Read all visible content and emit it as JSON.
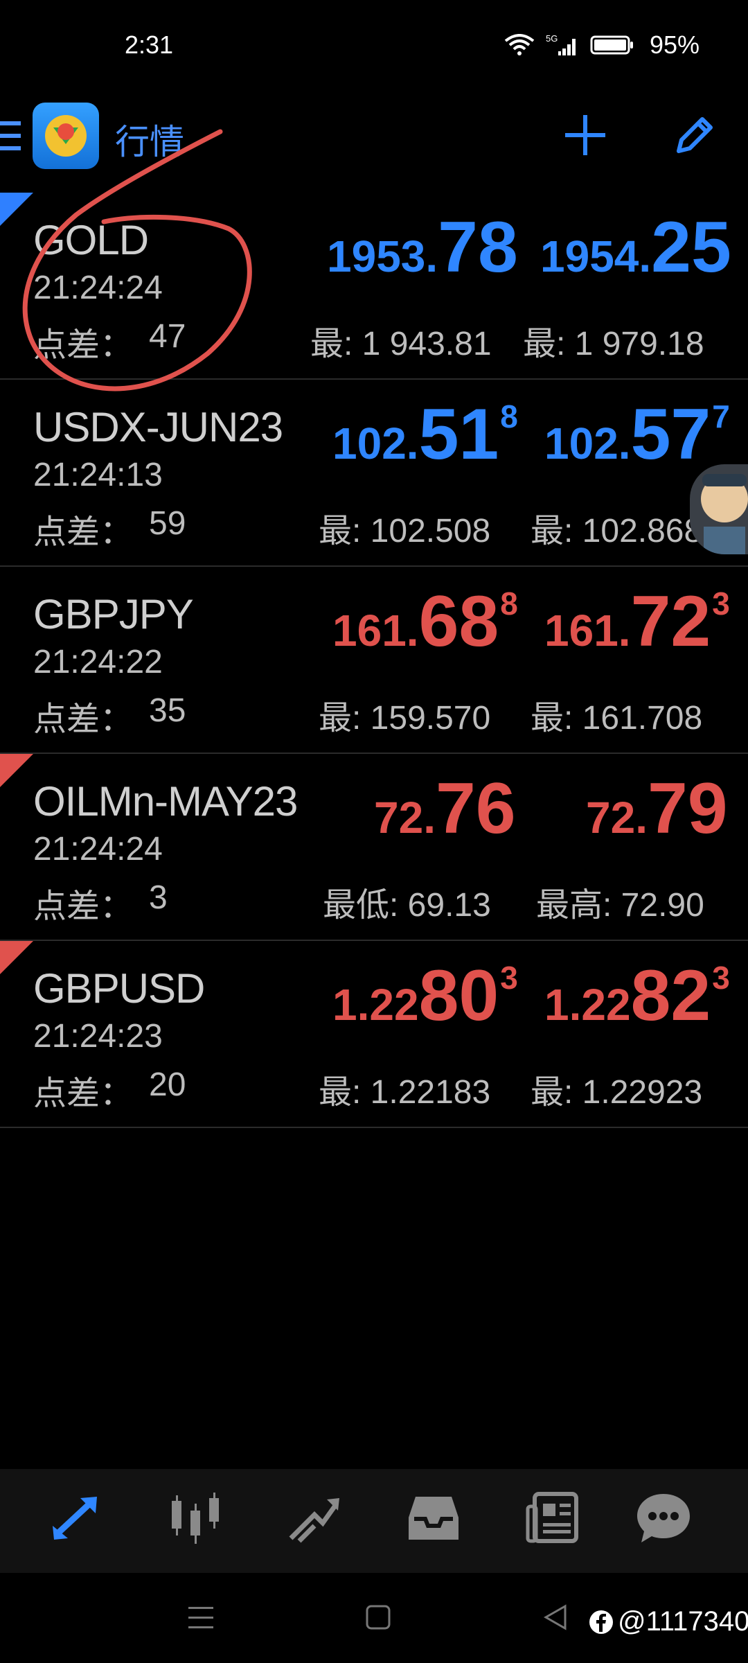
{
  "status": {
    "time": "2:31",
    "battery": "95%"
  },
  "header": {
    "title": "行情"
  },
  "quotes": [
    {
      "symbol": "GOLD",
      "time": "21:24:24",
      "spread_label": "点差：",
      "spread": "47",
      "bid_small": "1953.",
      "bid_big": "78",
      "bid_sup": "",
      "ask_small": "1954.",
      "ask_big": "25",
      "ask_sup": "",
      "low": "最: 1 943.81",
      "high": "最: 1 979.18",
      "color": "#2f86ff"
    },
    {
      "symbol": "USDX-JUN23",
      "time": "21:24:13",
      "spread_label": "点差：",
      "spread": "59",
      "bid_small": "102.",
      "bid_big": "51",
      "bid_sup": "8",
      "ask_small": "102.",
      "ask_big": "57",
      "ask_sup": "7",
      "low": "最: 102.508",
      "high": "最: 102.868",
      "color": "#2f86ff"
    },
    {
      "symbol": "GBPJPY",
      "time": "21:24:22",
      "spread_label": "点差：",
      "spread": "35",
      "bid_small": "161.",
      "bid_big": "68",
      "bid_sup": "8",
      "ask_small": "161.",
      "ask_big": "72",
      "ask_sup": "3",
      "low": "最: 159.570",
      "high": "最: 161.708",
      "color": "#e0524d"
    },
    {
      "symbol": "OILMn-MAY23",
      "time": "21:24:24",
      "spread_label": "点差：",
      "spread": "3",
      "bid_small": "72.",
      "bid_big": "76",
      "bid_sup": "",
      "ask_small": "72.",
      "ask_big": "79",
      "ask_sup": "",
      "low": "最低: 69.13",
      "high": "最高: 72.90",
      "color": "#e0524d"
    },
    {
      "symbol": "GBPUSD",
      "time": "21:24:23",
      "spread_label": "点差：",
      "spread": "20",
      "bid_small": "1.22",
      "bid_big": "80",
      "bid_sup": "3",
      "ask_small": "1.22",
      "ask_big": "82",
      "ask_sup": "3",
      "low": "最: 1.22183",
      "high": "最: 1.22923",
      "color": "#e0524d"
    }
  ],
  "watermark": "@1117340",
  "icons": {
    "menu": "menu-icon",
    "add": "plus-icon",
    "edit": "pencil-icon",
    "tab_quotes": "quotes-arrows-icon",
    "tab_chart": "candlestick-icon",
    "tab_trade": "trend-icon",
    "tab_history": "inbox-icon",
    "tab_news": "news-icon",
    "tab_chat": "chat-icon"
  },
  "colors": {
    "accent": "#2f86ff",
    "down": "#e0524d",
    "up": "#2f86ff"
  }
}
